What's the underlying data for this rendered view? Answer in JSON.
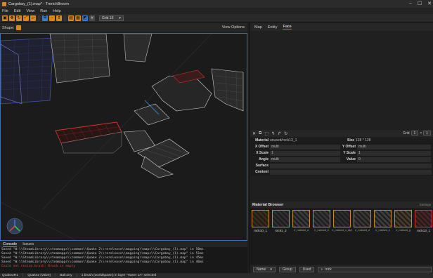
{
  "window": {
    "title": "Cargobay_(1).map* - TrenchBroom",
    "min": "–",
    "max": "☐",
    "close": "✕"
  },
  "menu": [
    "File",
    "Edit",
    "View",
    "Run",
    "Help"
  ],
  "toolbar": {
    "grid_label": "Grid 16"
  },
  "shape_bar": {
    "label": "Shape:",
    "view_options": "View Options"
  },
  "console": {
    "tabs": [
      "Console",
      "Issues"
    ],
    "lines": [
      "Saved \"W:\\\\SteamLibrary\\\\steamapps\\\\common\\\\Quake 2\\\\rerelease\\\\mapping\\\\maps\\\\Cargobay_(1).map\" in 50ms",
      "Saved \"W:\\\\SteamLibrary\\\\steamapps\\\\common\\\\Quake 2\\\\rerelease\\\\mapping\\\\maps\\\\Cargobay_(1).map\" in 51ms",
      "Saved \"W:\\\\SteamLibrary\\\\steamapps\\\\common\\\\Quake 2\\\\rerelease\\\\mapping\\\\maps\\\\Cargobay_(1).map\" in 45ms",
      "Saved \"W:\\\\SteamLibrary\\\\steamapps\\\\common\\\\Quake 2\\\\rerelease\\\\mapping\\\\maps\\\\Cargobay_(1).map\" in 46ms"
    ],
    "error_line": "Could not resize brush: Brush is empty"
  },
  "status": [
    "Quake2R1",
    "Quake2 (Valve)",
    "Balcony",
    "1 brush (worldspawn) in layer \"Tower 1A\" selected"
  ],
  "right_panel": {
    "tabs": [
      "Map",
      "Entity",
      "Face"
    ],
    "face_tools": [
      "✕",
      "⧉",
      "⬚",
      "↰",
      "↱",
      "↻"
    ],
    "grid": {
      "label": "Grid",
      "x": "1",
      "y": "1"
    },
    "material": {
      "label": "Material",
      "value": "unused/rock13_1",
      "size_label": "Size",
      "size": "128 * 128"
    },
    "x_offset": {
      "label": "X Offset",
      "value": "multi"
    },
    "y_offset": {
      "label": "Y Offset",
      "value": "multi"
    },
    "x_scale": {
      "label": "X Scale",
      "value": "1"
    },
    "y_scale": {
      "label": "Y Scale",
      "value": "1"
    },
    "angle": {
      "label": "Angle",
      "value": "multi"
    },
    "value": {
      "label": "Value",
      "value": "0"
    },
    "surface": {
      "label": "Surface"
    },
    "content": {
      "label": "Content"
    }
  },
  "material_browser": {
    "title": "Material Browser",
    "settings": "Settings",
    "tiles": [
      {
        "label": "rock10_1",
        "color": "#3a2a18"
      },
      {
        "label": "rock1_2",
        "color": "#2e2e30"
      },
      {
        "label": "rr_rocksed_a",
        "color": "#3a3a3e"
      },
      {
        "label": "rr_rocksed_b",
        "color": "#343436"
      },
      {
        "label": "rr_rocksed_c_alpha",
        "color": "#2c2c2e"
      },
      {
        "label": "rr_rocksed_d",
        "color": "#3a3636"
      },
      {
        "label": "rr_rocksed_e",
        "color": "#3d3d40"
      },
      {
        "label": "rr_rocksed_g",
        "color": "#4a3a2a"
      },
      {
        "label": "rock13_1",
        "color": "#4a2222"
      }
    ],
    "name_dropdown": "Name",
    "group_button": "Group",
    "used_button": "Used",
    "search_value": "rock"
  }
}
